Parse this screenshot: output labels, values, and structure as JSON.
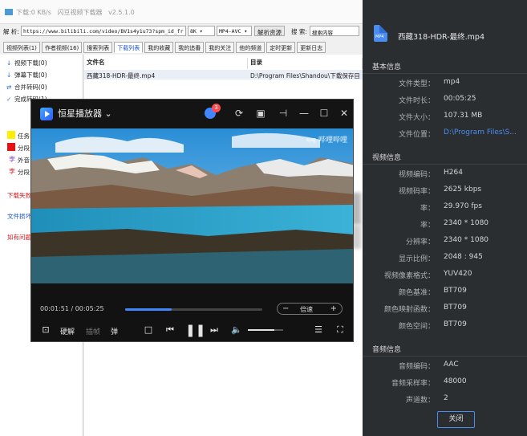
{
  "downloader": {
    "title_items": [
      "下载:0 KB/s",
      "闪豆视频下载器",
      "v2.5.1.0"
    ],
    "url_label": "解 析:",
    "url_value": "https://www.bilibili.com/video/BV1s4y1u73?spm_id_fr",
    "quality": "8K",
    "format": "MP4-AVC",
    "parse_button": "解析资源",
    "search_label": "搜 索:",
    "search_placeholder": "搜索内容",
    "tabs": [
      "视频列表(1)",
      "作者视频(16)",
      "搜索列表",
      "下载列表",
      "我的收藏",
      "我的追番",
      "我的关注",
      "他的频道",
      "定时更新",
      "更新日志"
    ],
    "tree": [
      {
        "glyph": "↓",
        "label": "视频下载(0)"
      },
      {
        "glyph": "↓",
        "label": "弹幕下载(0)"
      },
      {
        "glyph": "⇄",
        "label": "合并转码(0)"
      },
      {
        "glyph": "✓",
        "label": "完成转码(1)"
      }
    ],
    "legend": [
      {
        "color": "#ffee00",
        "label": "任务"
      },
      {
        "color": "#e81010",
        "label": "分段"
      },
      {
        "color": "",
        "label": "外音"
      },
      {
        "color": "",
        "label": "分段"
      }
    ],
    "red_links": [
      "下载失败",
      "文件损坏",
      "如有问题"
    ],
    "list_headers": [
      "文件名",
      "目录"
    ],
    "list_row": {
      "name": "西藏318-HDR-最终.mp4",
      "dir": "D:\\Program Files\\Shandou\\下载保存目"
    }
  },
  "player": {
    "name": "恒星播放器",
    "badge": "3",
    "watermark": "哔哩哔哩",
    "time": "00:01:51 / 00:05:25",
    "progress": 0.34,
    "speed_label": "倍速",
    "hard_decode": "硬解",
    "frame_label": "插帧",
    "danmaku": "弹",
    "volume": 0.75,
    "colors": {
      "accent": "#3f86ff",
      "badge": "#ff4d4f"
    }
  },
  "info": {
    "file_name": "西藏318-HDR-最终.mp4",
    "file_icon_text": "MP4",
    "sections": [
      {
        "title": "基本信息",
        "rows": [
          {
            "k": "文件类型：",
            "v": "mp4"
          },
          {
            "k": "文件时长：",
            "v": "00:05:25"
          },
          {
            "k": "文件大小：",
            "v": "107.31 MB"
          },
          {
            "k": "文件位置：",
            "v": "D:\\Program Files\\S..."
          }
        ]
      },
      {
        "title": "视频信息",
        "rows": [
          {
            "k": "视频编码：",
            "v": "H264"
          },
          {
            "k": "视频码率：",
            "v": "2625 kbps"
          },
          {
            "k": "率：",
            "v": "29.970 fps"
          },
          {
            "k": "率：",
            "v": "2340 * 1080"
          },
          {
            "k": "分辨率：",
            "v": "2340 * 1080"
          },
          {
            "k": "显示比例：",
            "v": "2048 : 945"
          },
          {
            "k": "视频像素格式：",
            "v": "YUV420"
          },
          {
            "k": "颜色基准：",
            "v": "BT709"
          },
          {
            "k": "颜色映射函数：",
            "v": "BT709"
          },
          {
            "k": "颜色空间：",
            "v": "BT709"
          }
        ]
      },
      {
        "title": "音频信息",
        "rows": [
          {
            "k": "音频编码：",
            "v": "AAC"
          },
          {
            "k": "音频采样率：",
            "v": "48000"
          },
          {
            "k": "声道数：",
            "v": "2"
          }
        ]
      }
    ],
    "close_button": "关闭",
    "colors": {
      "panel": "#2b2e31",
      "link": "#4a8cf0"
    }
  }
}
